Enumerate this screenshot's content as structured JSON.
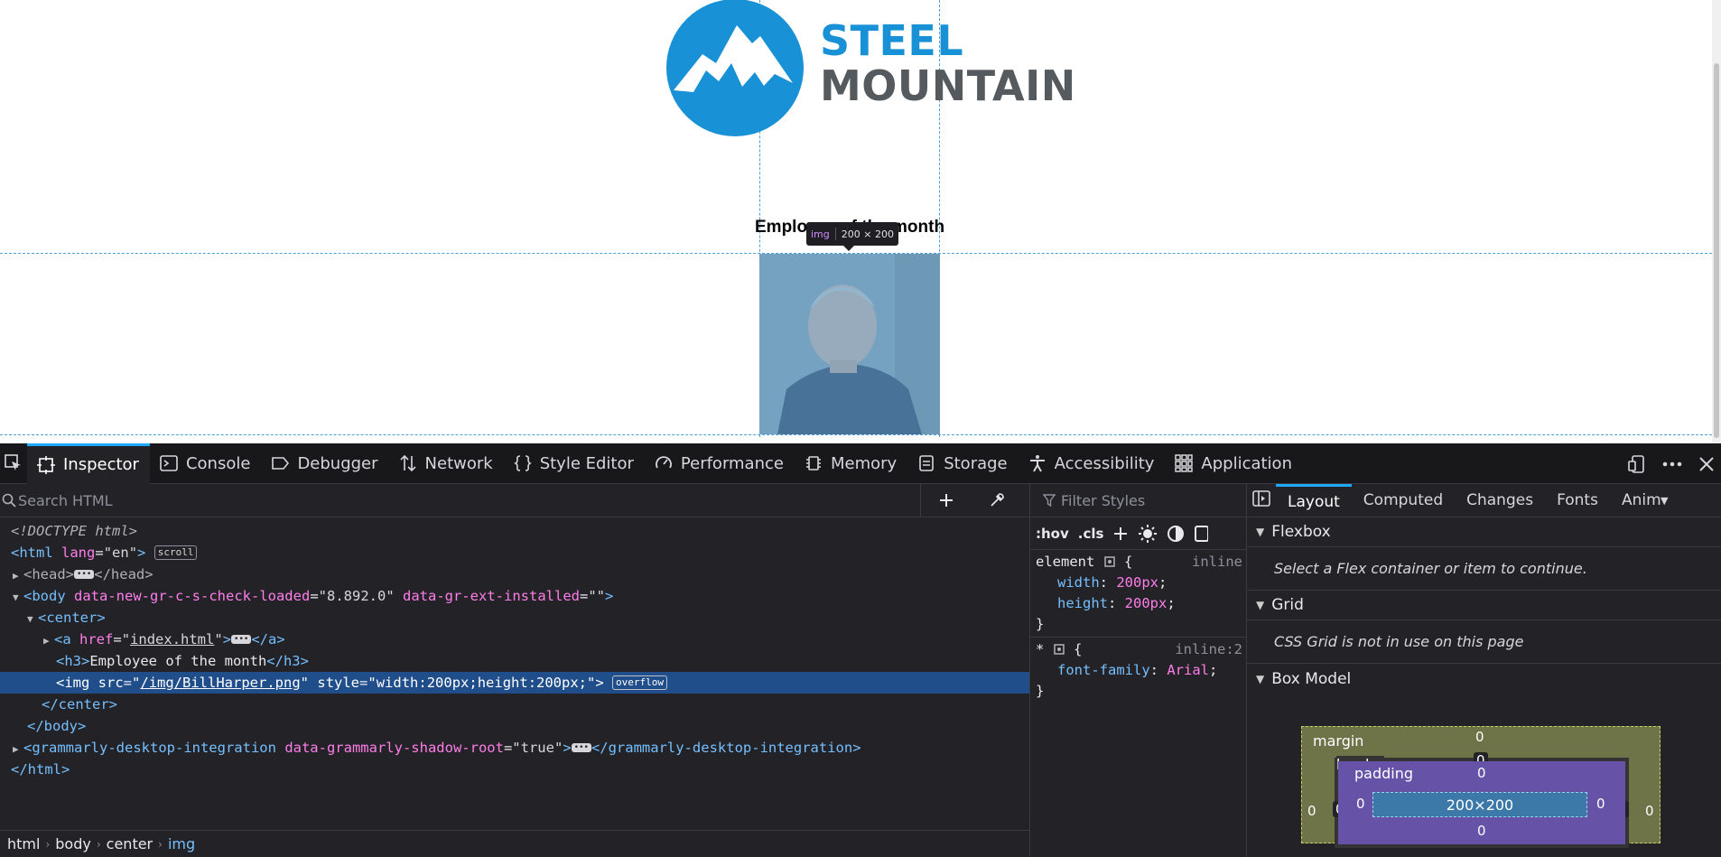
{
  "page": {
    "logo_word1": "STEEL",
    "logo_word2": "MOUNTAIN",
    "heading": "Employee of the month",
    "tooltip_tag": "img",
    "tooltip_size": "200 × 200"
  },
  "toolbar": {
    "tabs": [
      {
        "label": "Inspector",
        "icon": "inspector-icon"
      },
      {
        "label": "Console",
        "icon": "console-icon"
      },
      {
        "label": "Debugger",
        "icon": "debugger-icon"
      },
      {
        "label": "Network",
        "icon": "network-icon"
      },
      {
        "label": "Style Editor",
        "icon": "style-editor-icon"
      },
      {
        "label": "Performance",
        "icon": "performance-icon"
      },
      {
        "label": "Memory",
        "icon": "memory-icon"
      },
      {
        "label": "Storage",
        "icon": "storage-icon"
      },
      {
        "label": "Accessibility",
        "icon": "accessibility-icon"
      },
      {
        "label": "Application",
        "icon": "application-icon"
      }
    ]
  },
  "markup": {
    "search_placeholder": "Search HTML",
    "lines": {
      "doctype": "<!DOCTYPE html>",
      "html_lang": "en",
      "scroll_badge": "scroll",
      "body_attr1_name": "data-new-gr-c-s-check-loaded",
      "body_attr1_value": "8.892.0",
      "body_attr2_name": "data-gr-ext-installed",
      "body_attr2_value": "",
      "a_href": "index.html",
      "h3_text": "Employee of the month",
      "img_src": "/img/BillHarper.png",
      "img_style": "width:200px;height:200px;",
      "overflow_badge": "overflow",
      "grammarly_tag": "grammarly-desktop-integration",
      "grammarly_attr_name": "data-grammarly-shadow-root",
      "grammarly_attr_value": "true"
    },
    "breadcrumbs": [
      "html",
      "body",
      "center",
      "img"
    ]
  },
  "rules": {
    "filter_placeholder": "Filter Styles",
    "hov": ":hov",
    "cls": ".cls",
    "element_rule": {
      "selector": "element",
      "source": "inline",
      "decls": [
        {
          "prop": "width",
          "value": "200px"
        },
        {
          "prop": "height",
          "value": "200px"
        }
      ]
    },
    "star_rule": {
      "selector": "*",
      "source": "inline:2",
      "decls": [
        {
          "prop": "font-family",
          "value": "Arial"
        }
      ]
    }
  },
  "sidebar": {
    "tabs": [
      "Layout",
      "Computed",
      "Changes",
      "Fonts",
      "Animations"
    ],
    "flexbox_title": "Flexbox",
    "flexbox_msg": "Select a Flex container or item to continue.",
    "grid_title": "Grid",
    "grid_msg": "CSS Grid is not in use on this page",
    "boxmodel_title": "Box Model",
    "boxmodel": {
      "margin_label": "margin",
      "border_label": "border",
      "padding_label": "padding",
      "content_size": "200×200",
      "margin": "0",
      "border": "0",
      "padding": "0"
    }
  }
}
